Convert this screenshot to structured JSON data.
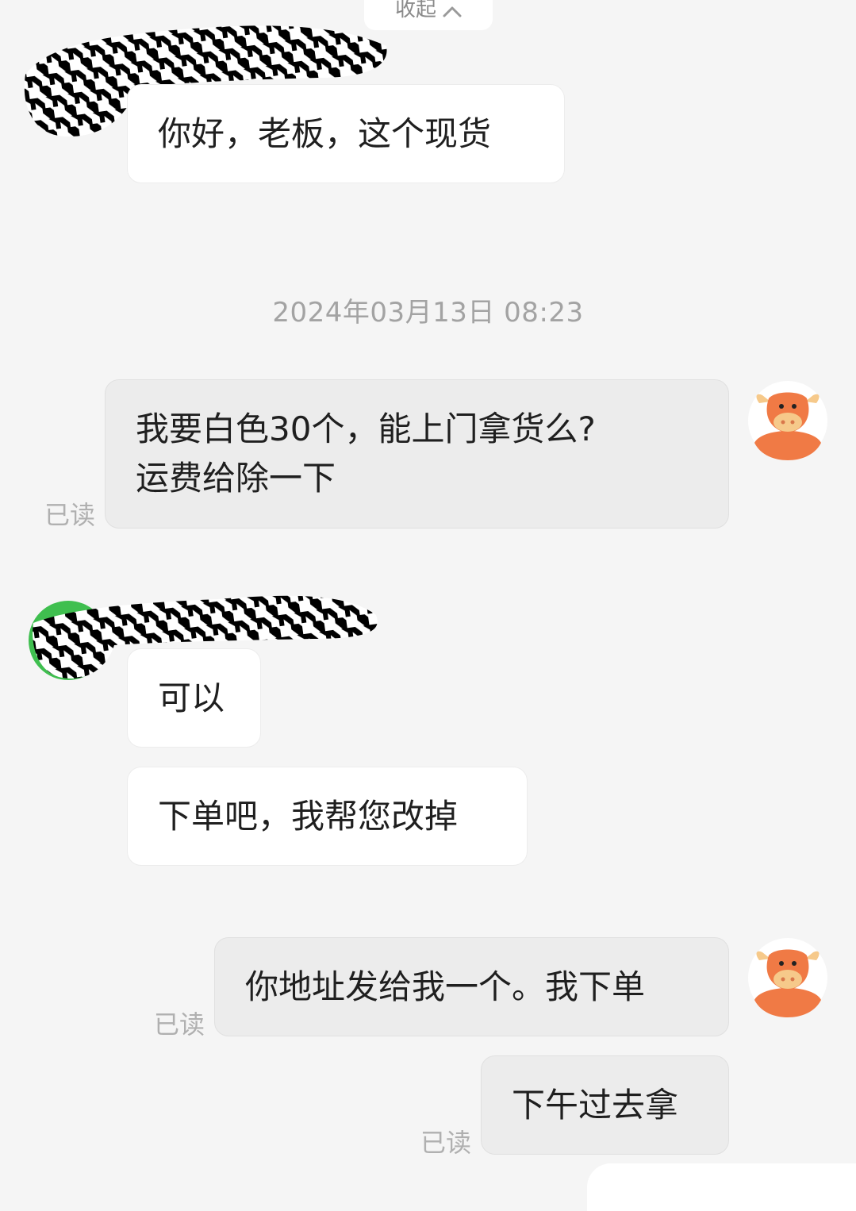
{
  "collapse": {
    "label": "收起",
    "icon": "chevron-up-icon"
  },
  "timestamp": "2024年03月13日 08:23",
  "messages": [
    {
      "side": "in",
      "text": "你好，老板，这个现货"
    },
    {
      "side": "out",
      "lines": [
        "我要白色30个，能上门拿货么?",
        "运费给除一下"
      ],
      "status": "已读"
    },
    {
      "side": "in",
      "text": "可以"
    },
    {
      "side": "in",
      "text": "下单吧，我帮您改掉"
    },
    {
      "side": "out",
      "text": "你地址发给我一个。我下单",
      "status": "已读"
    },
    {
      "side": "out",
      "text": "下午过去拿",
      "status": "已读"
    }
  ],
  "colors": {
    "background": "#f5f5f5",
    "incoming_bubble": "#ffffff",
    "outgoing_bubble": "#ececec",
    "avatar_orange": "#f07a45",
    "avatar_face": "#f6c98a",
    "seller_avatar_ring": "#3fbf4f"
  }
}
